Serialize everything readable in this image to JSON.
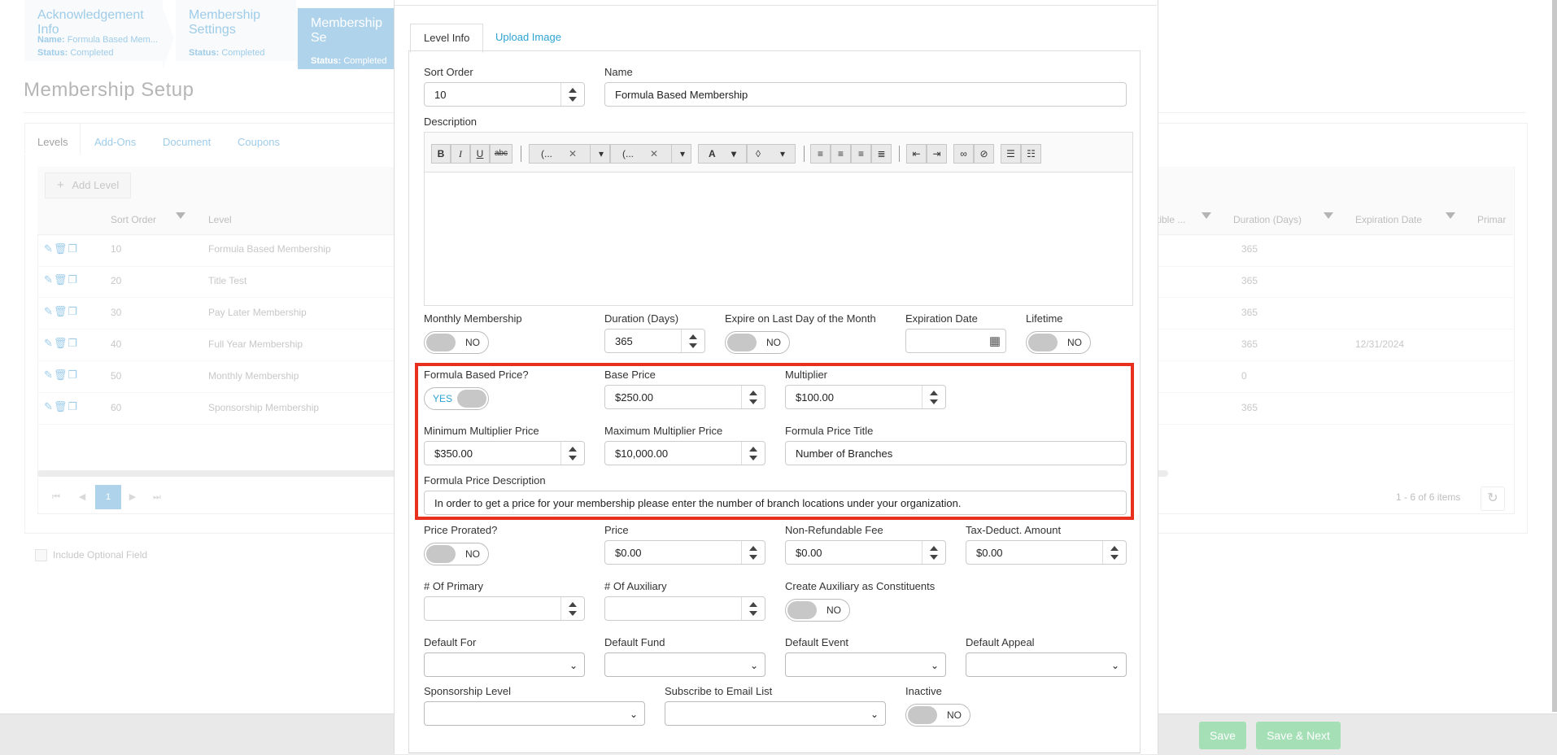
{
  "wizard": {
    "steps": [
      {
        "title": "Acknowledgement Info",
        "line1_label": "Name:",
        "line1_value": "Formula Based Mem...",
        "line2_label": "Status:",
        "line2_value": "Completed"
      },
      {
        "title": "Membership Settings",
        "line2_label": "Status:",
        "line2_value": "Completed"
      },
      {
        "title": "Membership Se",
        "line2_label": "Status:",
        "line2_value": "Completed"
      }
    ]
  },
  "page": {
    "title": "Membership Setup",
    "tabs": [
      "Levels",
      "Add-Ons",
      "Document",
      "Coupons"
    ],
    "add_level_label": "Add Level",
    "grid": {
      "columns_left": [
        "Sort Order",
        "Level"
      ],
      "columns_right": [
        "tible ...",
        "Duration (Days)",
        "Expiration Date",
        "Primar"
      ],
      "rows": [
        {
          "sort": "10",
          "level": "Formula Based Membership",
          "duration": "365",
          "expiration": ""
        },
        {
          "sort": "20",
          "level": "Title Test",
          "duration": "365",
          "expiration": ""
        },
        {
          "sort": "30",
          "level": "Pay Later Membership",
          "duration": "365",
          "expiration": ""
        },
        {
          "sort": "40",
          "level": "Full Year Membership",
          "duration": "365",
          "expiration": "12/31/2024"
        },
        {
          "sort": "50",
          "level": "Monthly Membership",
          "duration": "0",
          "expiration": ""
        },
        {
          "sort": "60",
          "level": "Sponsorship Membership",
          "duration": "365",
          "expiration": ""
        }
      ],
      "pager": {
        "current_page": "1",
        "info": "1 - 6 of 6 items"
      }
    },
    "include_optional_field": "Include Optional Field"
  },
  "footer": {
    "save": "Save",
    "save_next": "Save & Next"
  },
  "modal": {
    "tabs": [
      "Level Info",
      "Upload Image"
    ],
    "sort_order": {
      "label": "Sort Order",
      "value": "10"
    },
    "name": {
      "label": "Name",
      "value": "Formula Based Membership"
    },
    "description": {
      "label": "Description",
      "font_family_value": "(...",
      "font_size_value": "(...",
      "toolbar": {
        "bold": "B",
        "italic": "I",
        "underline": "U",
        "strike": "abc",
        "font_color": "A"
      }
    },
    "monthly_membership": {
      "label": "Monthly Membership",
      "value": "NO"
    },
    "duration": {
      "label": "Duration (Days)",
      "value": "365"
    },
    "expire_last_day": {
      "label": "Expire on Last Day of the Month",
      "value": "NO"
    },
    "expiration_date": {
      "label": "Expiration Date",
      "value": ""
    },
    "lifetime": {
      "label": "Lifetime",
      "value": "NO"
    },
    "formula_based_price": {
      "label": "Formula Based Price?",
      "value": "YES"
    },
    "base_price": {
      "label": "Base Price",
      "value": "$250.00"
    },
    "multiplier": {
      "label": "Multiplier",
      "value": "$100.00"
    },
    "min_multiplier_price": {
      "label": "Minimum Multiplier Price",
      "value": "$350.00"
    },
    "max_multiplier_price": {
      "label": "Maximum Multiplier Price",
      "value": "$10,000.00"
    },
    "formula_price_title": {
      "label": "Formula Price Title",
      "value": "Number of Branches"
    },
    "formula_price_description": {
      "label": "Formula Price Description",
      "value": "In order to get a price for your membership please enter the number of branch locations under your organization."
    },
    "price_prorated": {
      "label": "Price Prorated?",
      "value": "NO"
    },
    "price": {
      "label": "Price",
      "value": "$0.00"
    },
    "non_refundable_fee": {
      "label": "Non-Refundable Fee",
      "value": "$0.00"
    },
    "tax_deduct_amount": {
      "label": "Tax-Deduct. Amount",
      "value": "$0.00"
    },
    "num_primary": {
      "label": "# Of Primary",
      "value": ""
    },
    "num_auxiliary": {
      "label": "# Of Auxiliary",
      "value": ""
    },
    "create_auxiliary": {
      "label": "Create Auxiliary as Constituents",
      "value": "NO"
    },
    "default_for": {
      "label": "Default For"
    },
    "default_fund": {
      "label": "Default Fund"
    },
    "default_event": {
      "label": "Default Event"
    },
    "default_appeal": {
      "label": "Default Appeal"
    },
    "sponsorship_level": {
      "label": "Sponsorship Level"
    },
    "subscribe_email": {
      "label": "Subscribe to Email List"
    },
    "inactive": {
      "label": "Inactive",
      "value": "NO"
    }
  },
  "colors": {
    "accent": "#2ea3d3",
    "highlight": "#e8301f",
    "save_button": "#a4dfb6"
  }
}
